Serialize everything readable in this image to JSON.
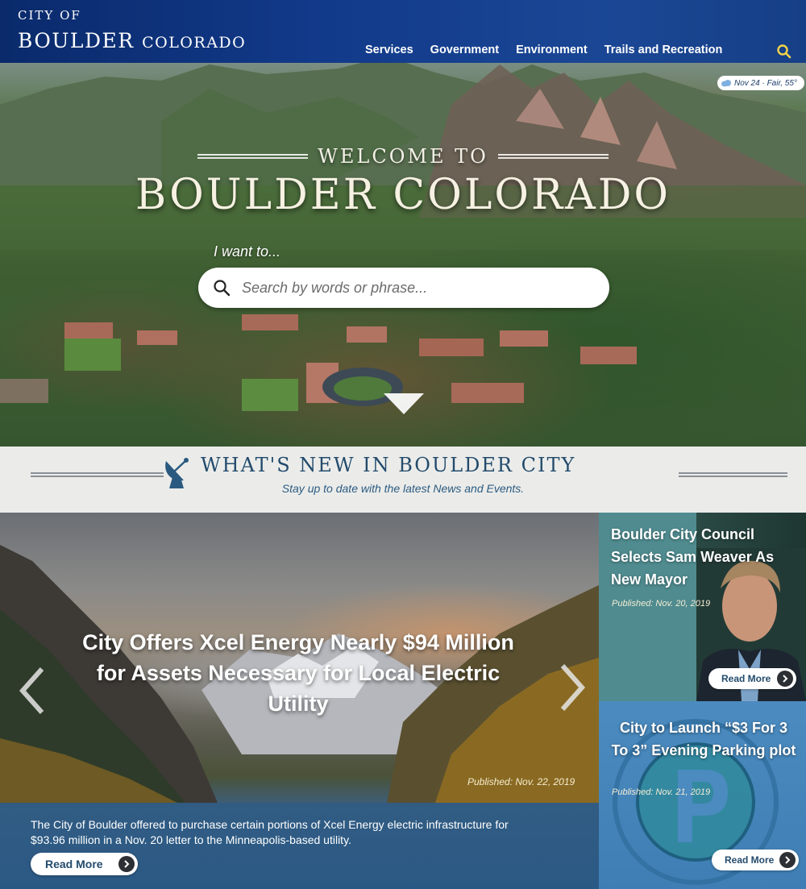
{
  "header": {
    "logo_small": "CITY OF",
    "logo_big_a": "BOULDER",
    "logo_big_b": "COLORADO",
    "nav": [
      "Services",
      "Government",
      "Environment",
      "Trails and Recreation"
    ],
    "search_icon": "search-icon",
    "weather": "Nov 24 · Fair, 55°"
  },
  "hero": {
    "welcome": "WELCOME TO",
    "title": "BOULDER COLORADO",
    "i_want": "I want to...",
    "search_placeholder": "Search by words or phrase...",
    "scroll_icon": "triangle-down-icon"
  },
  "news_band": {
    "icon": "satellite-dish-icon",
    "title": "WHAT'S NEW IN BOULDER CITY",
    "subtitle": "Stay up to date with the latest News and Events."
  },
  "featured": {
    "title": "City Offers Xcel Energy Nearly $94 Million for Assets Necessary for Local Electric Utility",
    "published": "Published: Nov. 22, 2019",
    "description": "The City of Boulder offered to purchase certain portions of Xcel Energy electric infrastructure for $93.96 million in a Nov. 20 letter to the Minneapolis-based utility.",
    "read_more": "Read More"
  },
  "side_stories": [
    {
      "title": "Boulder City Council Selects Sam Weaver As New Mayor",
      "published": "Published: Nov. 20, 2019",
      "read_more": "Read More"
    },
    {
      "title": "City to Launch “$3 For 3 To 3” Evening Parking plot",
      "published": "Published: Nov. 21, 2019",
      "read_more": "Read More"
    }
  ],
  "colors": {
    "header_blue": "#123a8a",
    "band_navy": "#234b6c",
    "side_teal": "#4f8b8f",
    "side_blue": "#4b8bbf"
  }
}
